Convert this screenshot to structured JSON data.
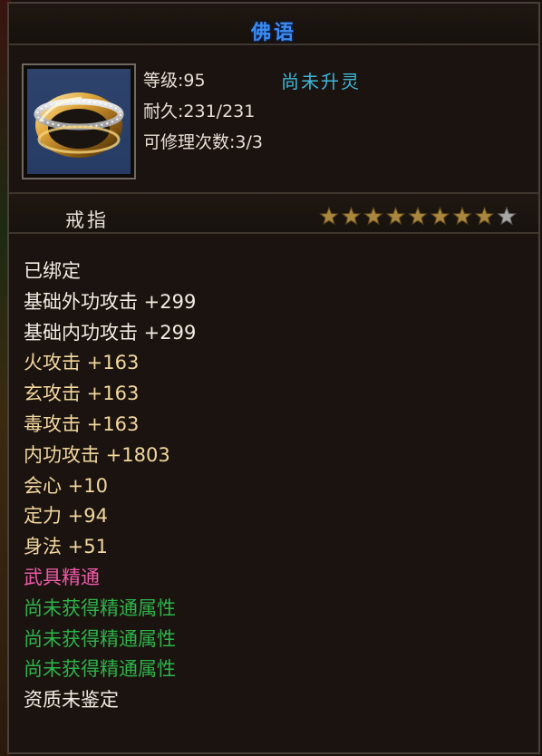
{
  "title": "佛语",
  "item": {
    "icon": "gold-ring-icon",
    "level": "等级:95",
    "durability": "耐久:231/231",
    "repair": "可修理次数:3/3",
    "ling_status": "尚未升灵",
    "type": "戒指",
    "stars_filled": 8,
    "stars_total": 9
  },
  "colors": {
    "white": "#f2ece4",
    "gold": "#f2d79e",
    "pink": "#f05aa8",
    "green": "#2eb34a",
    "title_blue": "#3b8cf0",
    "cyan": "#3fb7d8"
  },
  "attributes": [
    {
      "text": "已绑定",
      "color": "white"
    },
    {
      "text": "基础外功攻击 +299",
      "color": "white"
    },
    {
      "text": "基础内功攻击 +299",
      "color": "white"
    },
    {
      "text": "火攻击 +163",
      "color": "gold"
    },
    {
      "text": "玄攻击 +163",
      "color": "gold"
    },
    {
      "text": "毒攻击 +163",
      "color": "gold"
    },
    {
      "text": "内功攻击 +1803",
      "color": "gold"
    },
    {
      "text": "会心 +10",
      "color": "gold"
    },
    {
      "text": "定力 +94",
      "color": "gold"
    },
    {
      "text": "身法 +51",
      "color": "gold"
    },
    {
      "text": "武具精通",
      "color": "pink"
    },
    {
      "text": "尚未获得精通属性",
      "color": "green"
    },
    {
      "text": "尚未获得精通属性",
      "color": "green"
    },
    {
      "text": "尚未获得精通属性",
      "color": "green"
    },
    {
      "text": "资质未鉴定",
      "color": "white"
    }
  ]
}
